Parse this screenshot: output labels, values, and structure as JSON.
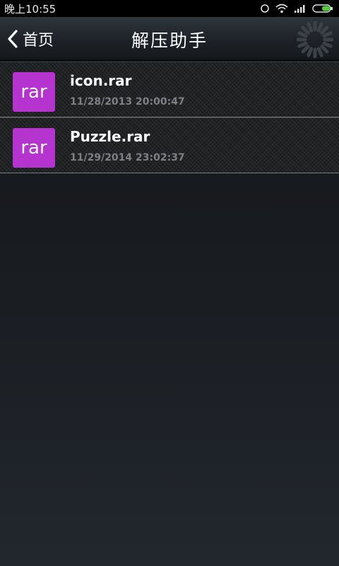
{
  "status_bar": {
    "time": "晚上10:55",
    "icons": [
      "sync-icon",
      "wifi-icon",
      "signal-icon",
      "battery-icon"
    ],
    "battery_color": "#4cd137"
  },
  "header": {
    "back_label": "首页",
    "title": "解压助手",
    "icons": [
      "back-chevron-icon",
      "loading-spinner-icon"
    ]
  },
  "files": [
    {
      "icon_label": "rar",
      "name": "icon.rar",
      "date": "11/28/2013 20:00:47"
    },
    {
      "icon_label": "rar",
      "name": "Puzzle.rar",
      "date": "11/29/2014 23:02:37"
    }
  ],
  "colors": {
    "file_icon_bg": "#b533cf",
    "date_text": "#7d8085"
  }
}
